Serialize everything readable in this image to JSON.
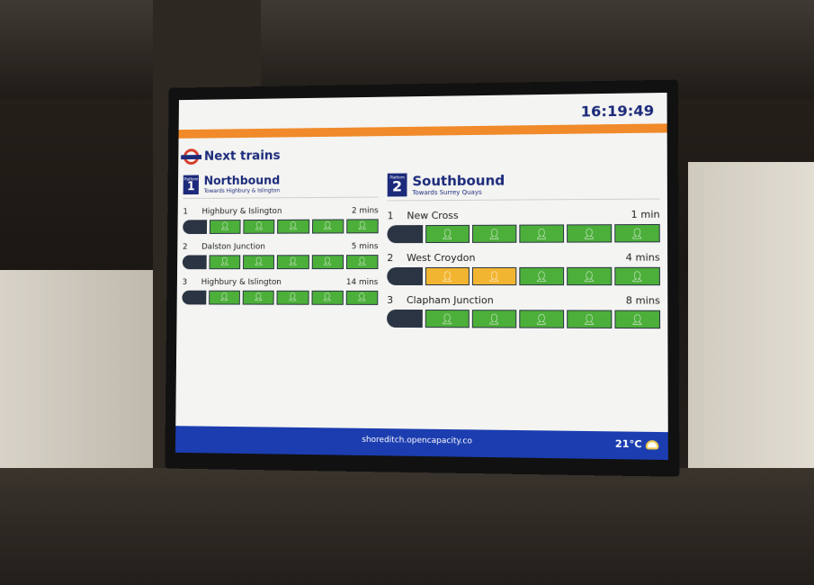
{
  "header": {
    "title": "Next trains",
    "clock": "16:19:49",
    "logo_icon": "tfl-roundel-icon"
  },
  "platforms": [
    {
      "platform_label": "Platform",
      "platform_number": "1",
      "direction": "Northbound",
      "towards": "Towards Highbury & Islington",
      "trains": [
        {
          "index": "1",
          "destination": "Highbury & Islington",
          "time": "2 mins",
          "cars": [
            "green",
            "green",
            "green",
            "green",
            "green"
          ]
        },
        {
          "index": "2",
          "destination": "Dalston Junction",
          "time": "5 mins",
          "cars": [
            "green",
            "green",
            "green",
            "green",
            "green"
          ]
        },
        {
          "index": "3",
          "destination": "Highbury & Islington",
          "time": "14 mins",
          "cars": [
            "green",
            "green",
            "green",
            "green",
            "green"
          ]
        }
      ]
    },
    {
      "platform_label": "Platform",
      "platform_number": "2",
      "direction": "Southbound",
      "towards": "Towards Surrey Quays",
      "trains": [
        {
          "index": "1",
          "destination": "New Cross",
          "time": "1 min",
          "cars": [
            "green",
            "green",
            "green",
            "green",
            "green"
          ]
        },
        {
          "index": "2",
          "destination": "West Croydon",
          "time": "4 mins",
          "cars": [
            "amber",
            "amber",
            "green",
            "green",
            "green"
          ]
        },
        {
          "index": "3",
          "destination": "Clapham Junction",
          "time": "8 mins",
          "cars": [
            "green",
            "green",
            "green",
            "green",
            "green"
          ]
        }
      ]
    }
  ],
  "footer": {
    "url": "shoreditch.opencapacity.co",
    "temperature": "21°C",
    "weather_icon": "partly-cloudy-icon"
  },
  "colors": {
    "tfl_blue": "#1b2a7a",
    "overground_orange": "#f08a2a",
    "capacity_low": "#4caf3a",
    "capacity_medium": "#f2b531",
    "footer_blue": "#1b3db0"
  }
}
